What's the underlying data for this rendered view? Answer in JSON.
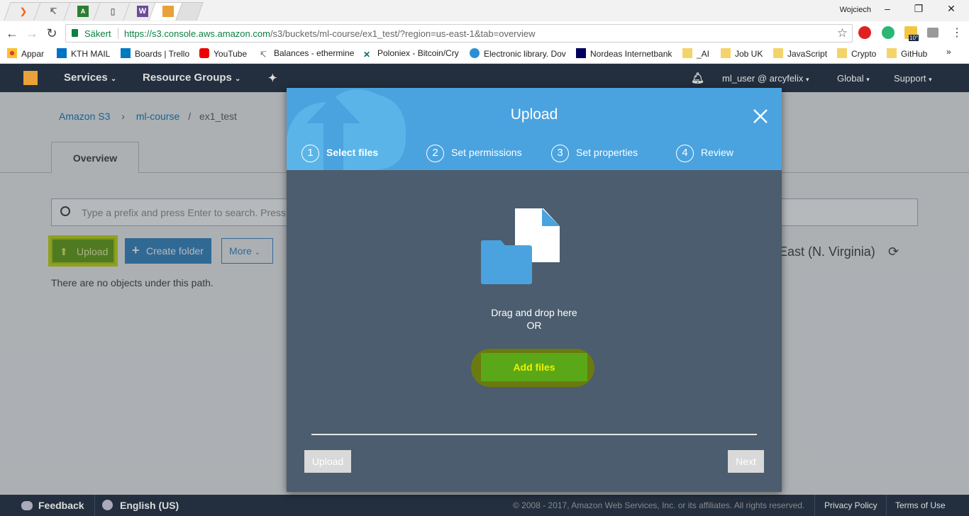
{
  "browser": {
    "user": "Wojciech",
    "secure_label": "Säkert",
    "url_host": "https://s3.console.aws.amazon.com",
    "url_path": "/s3/buckets/ml-course/ex1_test/?region=us-east-1&tab=overview",
    "weather_badge": "10°",
    "bookmarks": [
      "Appar",
      "KTH MAIL",
      "Boards | Trello",
      "YouTube",
      "Balances - ethermine",
      "Poloniex - Bitcoin/Cry",
      "Electronic library. Dov",
      "Nordeas Internetbank",
      "_AI",
      "Job UK",
      "JavaScript",
      "Crypto",
      "GitHub",
      "»"
    ]
  },
  "aws_nav": {
    "services": "Services",
    "resource_groups": "Resource Groups",
    "account": "ml_user @ arcyfelix",
    "region": "Global",
    "support": "Support"
  },
  "page": {
    "breadcrumb": [
      "Amazon S3",
      "ml-course",
      "ex1_test"
    ],
    "tab_overview": "Overview",
    "search_placeholder": "Type a prefix and press Enter to search. Press",
    "upload_btn": "Upload",
    "create_folder_btn": "Create folder",
    "more_btn": "More",
    "empty_msg": "There are no objects under this path.",
    "region_label": "East (N. Virginia)"
  },
  "modal": {
    "title": "Upload",
    "steps": [
      {
        "num": "1",
        "label": "Select files"
      },
      {
        "num": "2",
        "label": "Set permissions"
      },
      {
        "num": "3",
        "label": "Set properties"
      },
      {
        "num": "4",
        "label": "Review"
      }
    ],
    "drag_text": "Drag and drop here",
    "or_text": "OR",
    "add_files": "Add files",
    "upload_btn": "Upload",
    "next_btn": "Next"
  },
  "footer": {
    "feedback": "Feedback",
    "language": "English (US)",
    "copyright": "© 2008 - 2017, Amazon Web Services, Inc. or its affiliates. All rights reserved.",
    "privacy": "Privacy Policy",
    "terms": "Terms of Use"
  },
  "colors": {
    "aws_nav": "#232f3e",
    "modal_header": "#4aa3df",
    "modal_body": "#4b5d6e",
    "add_files": "#5aa817"
  }
}
